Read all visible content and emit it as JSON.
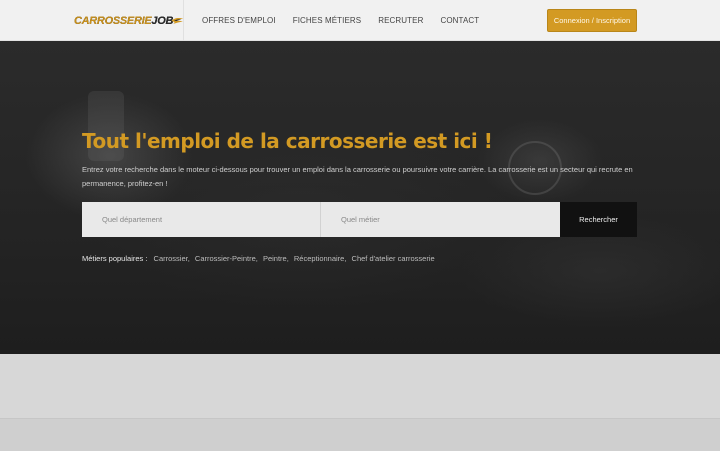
{
  "header": {
    "logo": {
      "text_primary": "CARROSSERIE",
      "text_secondary": "JOB"
    },
    "nav": [
      {
        "label": "OFFRES D'EMPLOI"
      },
      {
        "label": "FICHES MÉTIERS"
      },
      {
        "label": "RECRUTER"
      },
      {
        "label": "CONTACT"
      }
    ],
    "login_label": "Connexion / Inscription"
  },
  "hero": {
    "title": "Tout l'emploi de la carrosserie est ici !",
    "description": "Entrez votre recherche dans le moteur ci-dessous pour trouver un emploi dans la carrosserie ou poursuivre votre carrière. La carrosserie est un secteur qui recrute en permanence, profitez-en !",
    "search": {
      "department_placeholder": "Quel département",
      "job_placeholder": "Quel métier",
      "button_label": "Rechercher"
    },
    "popular": {
      "label": "Métiers populaires :",
      "items": [
        "Carrossier,",
        "Carrossier-Peintre,",
        "Peintre,",
        "Réceptionnaire,",
        "Chef d'atelier carrosserie"
      ]
    }
  },
  "colors": {
    "accent": "#d39a23",
    "header_bg": "#f1f1f1",
    "hero_bg": "#262626",
    "search_button_bg": "#111111"
  }
}
